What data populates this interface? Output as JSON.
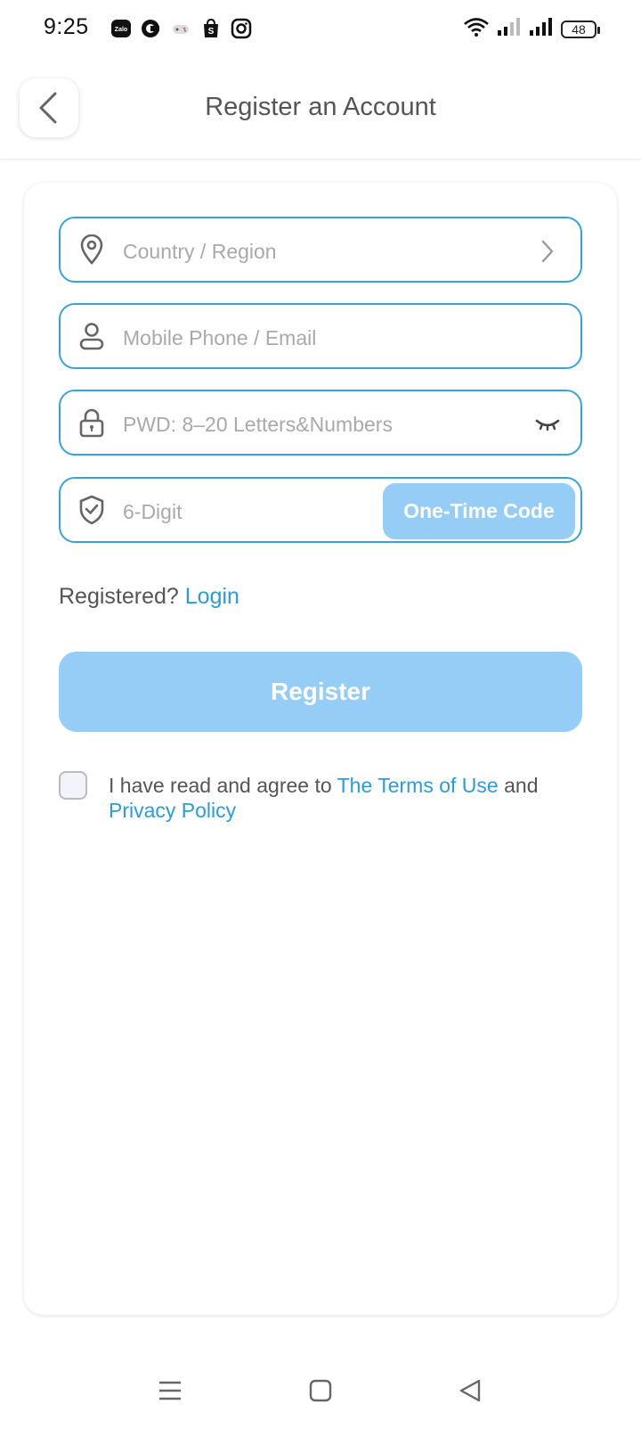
{
  "status_bar": {
    "time": "9:25",
    "battery": "48",
    "notification_icons": [
      "zalo-icon",
      "c-app-icon",
      "game-controller-icon",
      "shopee-icon",
      "instagram-icon"
    ]
  },
  "header": {
    "title": "Register an Account",
    "back_icon": "chevron-left-icon"
  },
  "form": {
    "country": {
      "placeholder": "Country / Region",
      "icon": "location-pin-icon",
      "tail_icon": "chevron-right-icon"
    },
    "account": {
      "placeholder": "Mobile Phone / Email",
      "icon": "user-icon"
    },
    "password": {
      "placeholder": "PWD: 8–20 Letters&Numbers",
      "icon": "lock-icon",
      "tail_icon": "eye-closed-icon"
    },
    "code": {
      "placeholder": "6-Digit",
      "icon": "shield-check-icon",
      "button_label": "One-Time Code"
    }
  },
  "login_prompt": {
    "text": "Registered?",
    "link": "Login"
  },
  "register_button": "Register",
  "agreement": {
    "prefix": "I have read and agree to",
    "terms_link": "The Terms of Use",
    "joiner": "and",
    "privacy_link": "Privacy Policy"
  },
  "colors": {
    "accent": "#2b9be0",
    "border": "#36a4dc",
    "button_disabled": "#95cdf6"
  },
  "nav_bar": {
    "icons": [
      "menu-icon",
      "home-square-icon",
      "back-triangle-icon"
    ]
  }
}
